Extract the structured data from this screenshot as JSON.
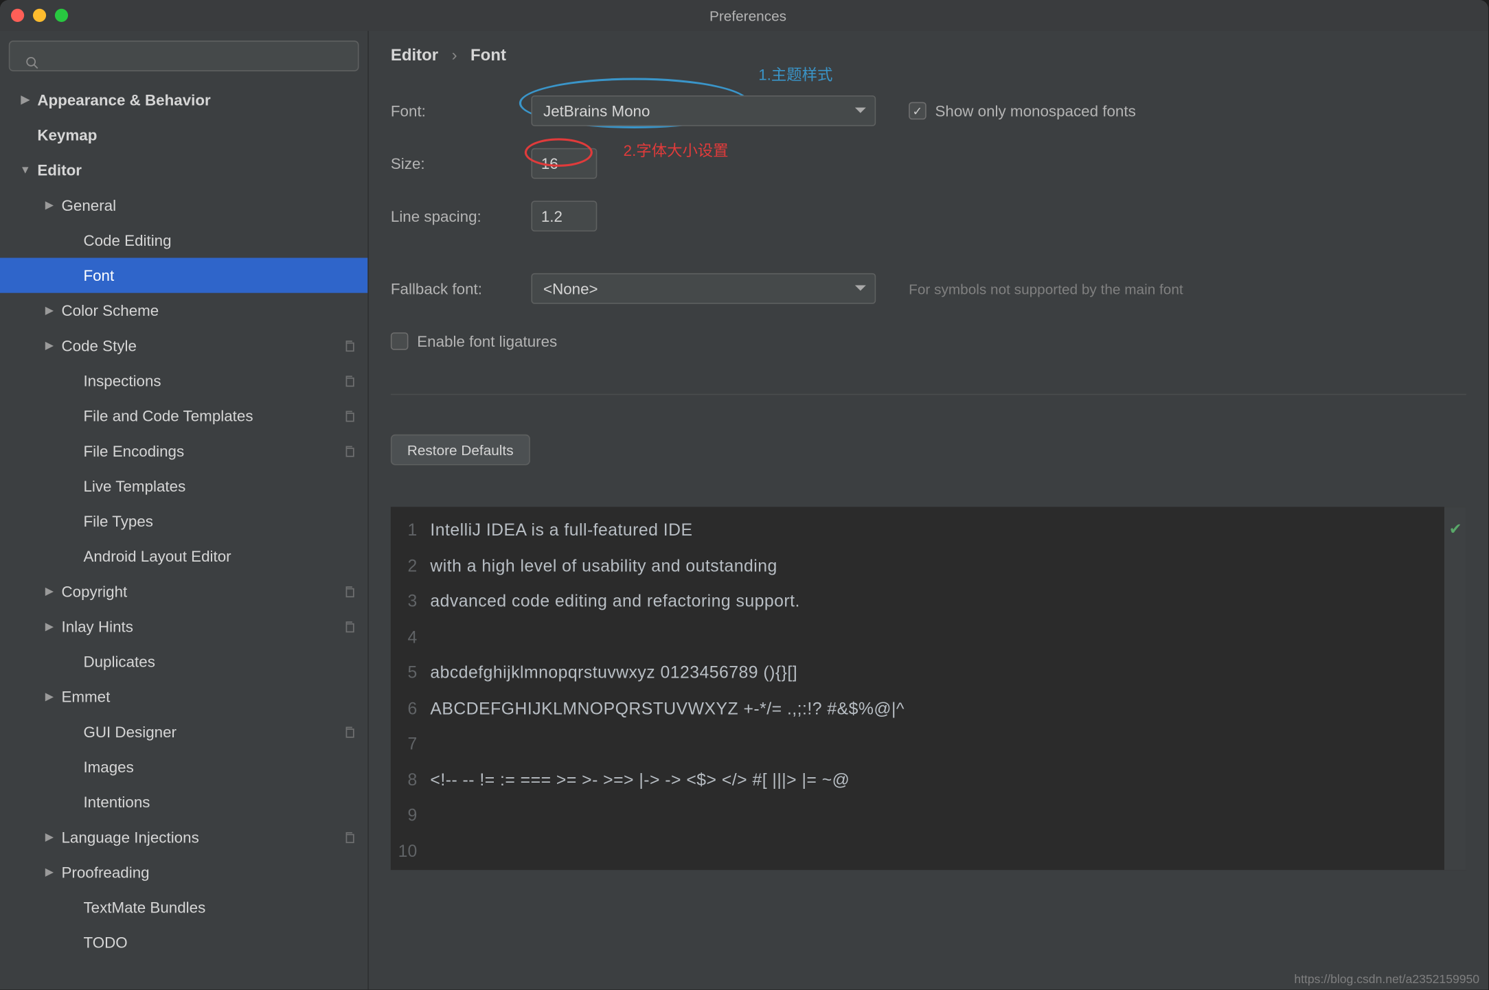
{
  "window": {
    "title": "Preferences"
  },
  "search": {
    "placeholder": ""
  },
  "sidebar": [
    {
      "label": "Appearance & Behavior",
      "depth": 0,
      "arrow": "right",
      "bold": true
    },
    {
      "label": "Keymap",
      "depth": 0,
      "arrow": "",
      "bold": true
    },
    {
      "label": "Editor",
      "depth": 0,
      "arrow": "down",
      "bold": true
    },
    {
      "label": "General",
      "depth": 1,
      "arrow": "right"
    },
    {
      "label": "Code Editing",
      "depth": 2,
      "arrow": ""
    },
    {
      "label": "Font",
      "depth": 2,
      "arrow": "",
      "selected": true
    },
    {
      "label": "Color Scheme",
      "depth": 1,
      "arrow": "right"
    },
    {
      "label": "Code Style",
      "depth": 1,
      "arrow": "right",
      "copy": true
    },
    {
      "label": "Inspections",
      "depth": 2,
      "arrow": "",
      "copy": true
    },
    {
      "label": "File and Code Templates",
      "depth": 2,
      "arrow": "",
      "copy": true
    },
    {
      "label": "File Encodings",
      "depth": 2,
      "arrow": "",
      "copy": true
    },
    {
      "label": "Live Templates",
      "depth": 2,
      "arrow": ""
    },
    {
      "label": "File Types",
      "depth": 2,
      "arrow": ""
    },
    {
      "label": "Android Layout Editor",
      "depth": 2,
      "arrow": ""
    },
    {
      "label": "Copyright",
      "depth": 1,
      "arrow": "right",
      "copy": true
    },
    {
      "label": "Inlay Hints",
      "depth": 1,
      "arrow": "right",
      "copy": true
    },
    {
      "label": "Duplicates",
      "depth": 2,
      "arrow": ""
    },
    {
      "label": "Emmet",
      "depth": 1,
      "arrow": "right"
    },
    {
      "label": "GUI Designer",
      "depth": 2,
      "arrow": "",
      "copy": true
    },
    {
      "label": "Images",
      "depth": 2,
      "arrow": ""
    },
    {
      "label": "Intentions",
      "depth": 2,
      "arrow": ""
    },
    {
      "label": "Language Injections",
      "depth": 1,
      "arrow": "right",
      "copy": true
    },
    {
      "label": "Proofreading",
      "depth": 1,
      "arrow": "right"
    },
    {
      "label": "TextMate Bundles",
      "depth": 2,
      "arrow": ""
    },
    {
      "label": "TODO",
      "depth": 2,
      "arrow": ""
    }
  ],
  "breadcrumb": {
    "parent": "Editor",
    "child": "Font"
  },
  "form": {
    "font_label": "Font:",
    "font_value": "JetBrains Mono",
    "mono_label": "Show only monospaced fonts",
    "size_label": "Size:",
    "size_value": "16",
    "spacing_label": "Line spacing:",
    "spacing_value": "1.2",
    "fallback_label": "Fallback font:",
    "fallback_value": "<None>",
    "fallback_hint": "For symbols not supported by the main font",
    "ligatures_label": "Enable font ligatures",
    "restore_label": "Restore Defaults"
  },
  "annotations": {
    "blue": "1.主题样式",
    "red": "2.字体大小设置"
  },
  "preview": {
    "lines": [
      "IntelliJ IDEA is a full-featured IDE",
      "with a high level of usability and outstanding",
      "advanced code editing and refactoring support.",
      "",
      "abcdefghijklmnopqrstuvwxyz 0123456789 (){}[]",
      "ABCDEFGHIJKLMNOPQRSTUVWXYZ +-*/= .,;:!? #&$%@|^",
      "",
      "<!-- -- != := === >= >- >=> |-> -> <$> </> #[ |||> |= ~@",
      "",
      ""
    ]
  },
  "watermark": "https://blog.csdn.net/a2352159950"
}
